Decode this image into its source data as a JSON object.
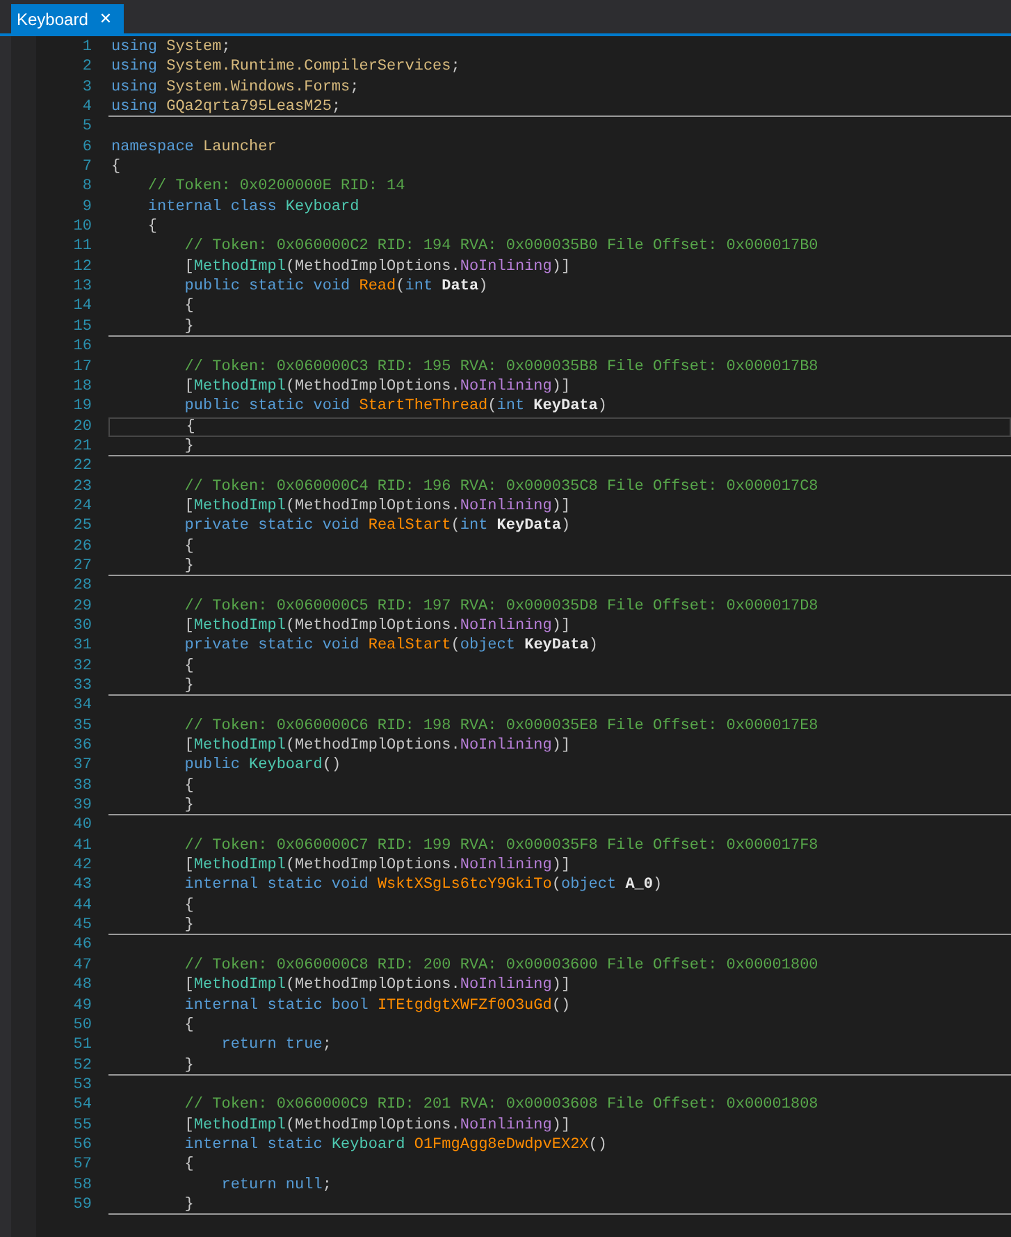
{
  "tabs": [
    {
      "label": "Keyboard",
      "close": "✕",
      "selected": true
    }
  ],
  "lines": [
    {
      "n": "1",
      "divider": false,
      "current": false,
      "tokens": [
        {
          "kind": "kw",
          "text": "using "
        },
        {
          "kind": "ns",
          "text": "System"
        },
        {
          "kind": "punct",
          "text": ";"
        }
      ]
    },
    {
      "n": "2",
      "divider": false,
      "current": false,
      "tokens": [
        {
          "kind": "kw",
          "text": "using "
        },
        {
          "kind": "ns",
          "text": "System.Runtime.CompilerServices"
        },
        {
          "kind": "punct",
          "text": ";"
        }
      ]
    },
    {
      "n": "3",
      "divider": false,
      "current": false,
      "tokens": [
        {
          "kind": "kw",
          "text": "using "
        },
        {
          "kind": "ns",
          "text": "System.Windows.Forms"
        },
        {
          "kind": "punct",
          "text": ";"
        }
      ]
    },
    {
      "n": "4",
      "divider": true,
      "current": false,
      "tokens": [
        {
          "kind": "kw",
          "text": "using "
        },
        {
          "kind": "ns",
          "text": "GQa2qrta795LeasM25"
        },
        {
          "kind": "punct",
          "text": ";"
        }
      ]
    },
    {
      "n": "5",
      "divider": false,
      "current": false
    },
    {
      "n": "6",
      "divider": false,
      "current": false,
      "tokens": [
        {
          "kind": "kw",
          "text": "namespace "
        },
        {
          "kind": "ns",
          "text": "Launcher"
        }
      ]
    },
    {
      "n": "7",
      "divider": false,
      "current": false,
      "tokens": [
        {
          "kind": "punct",
          "text": "{"
        }
      ]
    },
    {
      "n": "8",
      "divider": false,
      "current": false,
      "tokens": [
        {
          "kind": "comment",
          "text": "    // Token: 0x0200000E RID: 14"
        }
      ]
    },
    {
      "n": "9",
      "divider": false,
      "current": false,
      "tokens": [
        {
          "kind": "kw",
          "text": "    internal class "
        },
        {
          "kind": "type",
          "text": "Keyboard"
        }
      ]
    },
    {
      "n": "10",
      "divider": false,
      "current": false,
      "tokens": [
        {
          "kind": "punct",
          "text": "    {"
        }
      ]
    },
    {
      "n": "11",
      "divider": false,
      "current": false,
      "tokens": [
        {
          "kind": "comment",
          "text": "        // Token: 0x060000C2 RID: 194 RVA: 0x000035B0 File Offset: 0x000017B0"
        }
      ]
    },
    {
      "n": "12",
      "divider": false,
      "current": false,
      "tokens": [
        {
          "kind": "punct",
          "text": "        ["
        },
        {
          "kind": "type",
          "text": "MethodImpl"
        },
        {
          "kind": "punct",
          "text": "(MethodImplOptions."
        },
        {
          "kind": "enum",
          "text": "NoInlining"
        },
        {
          "kind": "punct",
          "text": ")]"
        }
      ]
    },
    {
      "n": "13",
      "divider": false,
      "current": false,
      "tokens": [
        {
          "kind": "kw",
          "text": "        public static void "
        },
        {
          "kind": "method",
          "text": "Read"
        },
        {
          "kind": "punct",
          "text": "("
        },
        {
          "kind": "kw",
          "text": "int "
        },
        {
          "kind": "param",
          "text": "Data"
        },
        {
          "kind": "punct",
          "text": ")"
        }
      ]
    },
    {
      "n": "14",
      "divider": false,
      "current": false,
      "tokens": [
        {
          "kind": "punct",
          "text": "        {"
        }
      ]
    },
    {
      "n": "15",
      "divider": true,
      "current": false,
      "tokens": [
        {
          "kind": "punct",
          "text": "        }"
        }
      ]
    },
    {
      "n": "16",
      "divider": false,
      "current": false
    },
    {
      "n": "17",
      "divider": false,
      "current": false,
      "tokens": [
        {
          "kind": "comment",
          "text": "        // Token: 0x060000C3 RID: 195 RVA: 0x000035B8 File Offset: 0x000017B8"
        }
      ]
    },
    {
      "n": "18",
      "divider": false,
      "current": false,
      "tokens": [
        {
          "kind": "punct",
          "text": "        ["
        },
        {
          "kind": "type",
          "text": "MethodImpl"
        },
        {
          "kind": "punct",
          "text": "(MethodImplOptions."
        },
        {
          "kind": "enum",
          "text": "NoInlining"
        },
        {
          "kind": "punct",
          "text": ")]"
        }
      ]
    },
    {
      "n": "19",
      "divider": false,
      "current": false,
      "tokens": [
        {
          "kind": "kw",
          "text": "        public static void "
        },
        {
          "kind": "method",
          "text": "StartTheThread"
        },
        {
          "kind": "punct",
          "text": "("
        },
        {
          "kind": "kw",
          "text": "int "
        },
        {
          "kind": "param",
          "text": "KeyData"
        },
        {
          "kind": "punct",
          "text": ")"
        }
      ]
    },
    {
      "n": "20",
      "divider": false,
      "current": true,
      "tokens": [
        {
          "kind": "punct",
          "text": "        {"
        }
      ]
    },
    {
      "n": "21",
      "divider": true,
      "current": false,
      "tokens": [
        {
          "kind": "punct",
          "text": "        }"
        }
      ]
    },
    {
      "n": "22",
      "divider": false,
      "current": false
    },
    {
      "n": "23",
      "divider": false,
      "current": false,
      "tokens": [
        {
          "kind": "comment",
          "text": "        // Token: 0x060000C4 RID: 196 RVA: 0x000035C8 File Offset: 0x000017C8"
        }
      ]
    },
    {
      "n": "24",
      "divider": false,
      "current": false,
      "tokens": [
        {
          "kind": "punct",
          "text": "        ["
        },
        {
          "kind": "type",
          "text": "MethodImpl"
        },
        {
          "kind": "punct",
          "text": "(MethodImplOptions."
        },
        {
          "kind": "enum",
          "text": "NoInlining"
        },
        {
          "kind": "punct",
          "text": ")]"
        }
      ]
    },
    {
      "n": "25",
      "divider": false,
      "current": false,
      "tokens": [
        {
          "kind": "kw",
          "text": "        private static void "
        },
        {
          "kind": "method",
          "text": "RealStart"
        },
        {
          "kind": "punct",
          "text": "("
        },
        {
          "kind": "kw",
          "text": "int "
        },
        {
          "kind": "param",
          "text": "KeyData"
        },
        {
          "kind": "punct",
          "text": ")"
        }
      ]
    },
    {
      "n": "26",
      "divider": false,
      "current": false,
      "tokens": [
        {
          "kind": "punct",
          "text": "        {"
        }
      ]
    },
    {
      "n": "27",
      "divider": true,
      "current": false,
      "tokens": [
        {
          "kind": "punct",
          "text": "        }"
        }
      ]
    },
    {
      "n": "28",
      "divider": false,
      "current": false
    },
    {
      "n": "29",
      "divider": false,
      "current": false,
      "tokens": [
        {
          "kind": "comment",
          "text": "        // Token: 0x060000C5 RID: 197 RVA: 0x000035D8 File Offset: 0x000017D8"
        }
      ]
    },
    {
      "n": "30",
      "divider": false,
      "current": false,
      "tokens": [
        {
          "kind": "punct",
          "text": "        ["
        },
        {
          "kind": "type",
          "text": "MethodImpl"
        },
        {
          "kind": "punct",
          "text": "(MethodImplOptions."
        },
        {
          "kind": "enum",
          "text": "NoInlining"
        },
        {
          "kind": "punct",
          "text": ")]"
        }
      ]
    },
    {
      "n": "31",
      "divider": false,
      "current": false,
      "tokens": [
        {
          "kind": "kw",
          "text": "        private static void "
        },
        {
          "kind": "method",
          "text": "RealStart"
        },
        {
          "kind": "punct",
          "text": "("
        },
        {
          "kind": "kw",
          "text": "object "
        },
        {
          "kind": "param",
          "text": "KeyData"
        },
        {
          "kind": "punct",
          "text": ")"
        }
      ]
    },
    {
      "n": "32",
      "divider": false,
      "current": false,
      "tokens": [
        {
          "kind": "punct",
          "text": "        {"
        }
      ]
    },
    {
      "n": "33",
      "divider": true,
      "current": false,
      "tokens": [
        {
          "kind": "punct",
          "text": "        }"
        }
      ]
    },
    {
      "n": "34",
      "divider": false,
      "current": false
    },
    {
      "n": "35",
      "divider": false,
      "current": false,
      "tokens": [
        {
          "kind": "comment",
          "text": "        // Token: 0x060000C6 RID: 198 RVA: 0x000035E8 File Offset: 0x000017E8"
        }
      ]
    },
    {
      "n": "36",
      "divider": false,
      "current": false,
      "tokens": [
        {
          "kind": "punct",
          "text": "        ["
        },
        {
          "kind": "type",
          "text": "MethodImpl"
        },
        {
          "kind": "punct",
          "text": "(MethodImplOptions."
        },
        {
          "kind": "enum",
          "text": "NoInlining"
        },
        {
          "kind": "punct",
          "text": ")]"
        }
      ]
    },
    {
      "n": "37",
      "divider": false,
      "current": false,
      "tokens": [
        {
          "kind": "kw",
          "text": "        public "
        },
        {
          "kind": "type",
          "text": "Keyboard"
        },
        {
          "kind": "punct",
          "text": "()"
        }
      ]
    },
    {
      "n": "38",
      "divider": false,
      "current": false,
      "tokens": [
        {
          "kind": "punct",
          "text": "        {"
        }
      ]
    },
    {
      "n": "39",
      "divider": true,
      "current": false,
      "tokens": [
        {
          "kind": "punct",
          "text": "        }"
        }
      ]
    },
    {
      "n": "40",
      "divider": false,
      "current": false
    },
    {
      "n": "41",
      "divider": false,
      "current": false,
      "tokens": [
        {
          "kind": "comment",
          "text": "        // Token: 0x060000C7 RID: 199 RVA: 0x000035F8 File Offset: 0x000017F8"
        }
      ]
    },
    {
      "n": "42",
      "divider": false,
      "current": false,
      "tokens": [
        {
          "kind": "punct",
          "text": "        ["
        },
        {
          "kind": "type",
          "text": "MethodImpl"
        },
        {
          "kind": "punct",
          "text": "(MethodImplOptions."
        },
        {
          "kind": "enum",
          "text": "NoInlining"
        },
        {
          "kind": "punct",
          "text": ")]"
        }
      ]
    },
    {
      "n": "43",
      "divider": false,
      "current": false,
      "tokens": [
        {
          "kind": "kw",
          "text": "        internal static void "
        },
        {
          "kind": "method",
          "text": "WsktXSgLs6tcY9GkiTo"
        },
        {
          "kind": "punct",
          "text": "("
        },
        {
          "kind": "kw",
          "text": "object "
        },
        {
          "kind": "param",
          "text": "A_0"
        },
        {
          "kind": "punct",
          "text": ")"
        }
      ]
    },
    {
      "n": "44",
      "divider": false,
      "current": false,
      "tokens": [
        {
          "kind": "punct",
          "text": "        {"
        }
      ]
    },
    {
      "n": "45",
      "divider": true,
      "current": false,
      "tokens": [
        {
          "kind": "punct",
          "text": "        }"
        }
      ]
    },
    {
      "n": "46",
      "divider": false,
      "current": false
    },
    {
      "n": "47",
      "divider": false,
      "current": false,
      "tokens": [
        {
          "kind": "comment",
          "text": "        // Token: 0x060000C8 RID: 200 RVA: 0x00003600 File Offset: 0x00001800"
        }
      ]
    },
    {
      "n": "48",
      "divider": false,
      "current": false,
      "tokens": [
        {
          "kind": "punct",
          "text": "        ["
        },
        {
          "kind": "type",
          "text": "MethodImpl"
        },
        {
          "kind": "punct",
          "text": "(MethodImplOptions."
        },
        {
          "kind": "enum",
          "text": "NoInlining"
        },
        {
          "kind": "punct",
          "text": ")]"
        }
      ]
    },
    {
      "n": "49",
      "divider": false,
      "current": false,
      "tokens": [
        {
          "kind": "kw",
          "text": "        internal static bool "
        },
        {
          "kind": "method",
          "text": "ITEtgdgtXWFZf0O3uGd"
        },
        {
          "kind": "punct",
          "text": "()"
        }
      ]
    },
    {
      "n": "50",
      "divider": false,
      "current": false,
      "tokens": [
        {
          "kind": "punct",
          "text": "        {"
        }
      ]
    },
    {
      "n": "51",
      "divider": false,
      "current": false,
      "tokens": [
        {
          "kind": "kw",
          "text": "            return true"
        },
        {
          "kind": "punct",
          "text": ";"
        }
      ]
    },
    {
      "n": "52",
      "divider": true,
      "current": false,
      "tokens": [
        {
          "kind": "punct",
          "text": "        }"
        }
      ]
    },
    {
      "n": "53",
      "divider": false,
      "current": false
    },
    {
      "n": "54",
      "divider": false,
      "current": false,
      "tokens": [
        {
          "kind": "comment",
          "text": "        // Token: 0x060000C9 RID: 201 RVA: 0x00003608 File Offset: 0x00001808"
        }
      ]
    },
    {
      "n": "55",
      "divider": false,
      "current": false,
      "tokens": [
        {
          "kind": "punct",
          "text": "        ["
        },
        {
          "kind": "type",
          "text": "MethodImpl"
        },
        {
          "kind": "punct",
          "text": "(MethodImplOptions."
        },
        {
          "kind": "enum",
          "text": "NoInlining"
        },
        {
          "kind": "punct",
          "text": ")]"
        }
      ]
    },
    {
      "n": "56",
      "divider": false,
      "current": false,
      "tokens": [
        {
          "kind": "kw",
          "text": "        internal static "
        },
        {
          "kind": "type",
          "text": "Keyboard "
        },
        {
          "kind": "method",
          "text": "O1FmgAgg8eDwdpvEX2X"
        },
        {
          "kind": "punct",
          "text": "()"
        }
      ]
    },
    {
      "n": "57",
      "divider": false,
      "current": false,
      "tokens": [
        {
          "kind": "punct",
          "text": "        {"
        }
      ]
    },
    {
      "n": "58",
      "divider": false,
      "current": false,
      "tokens": [
        {
          "kind": "kw",
          "text": "            return null"
        },
        {
          "kind": "punct",
          "text": ";"
        }
      ]
    },
    {
      "n": "59",
      "divider": true,
      "current": false,
      "tokens": [
        {
          "kind": "punct",
          "text": "        }"
        }
      ]
    }
  ]
}
